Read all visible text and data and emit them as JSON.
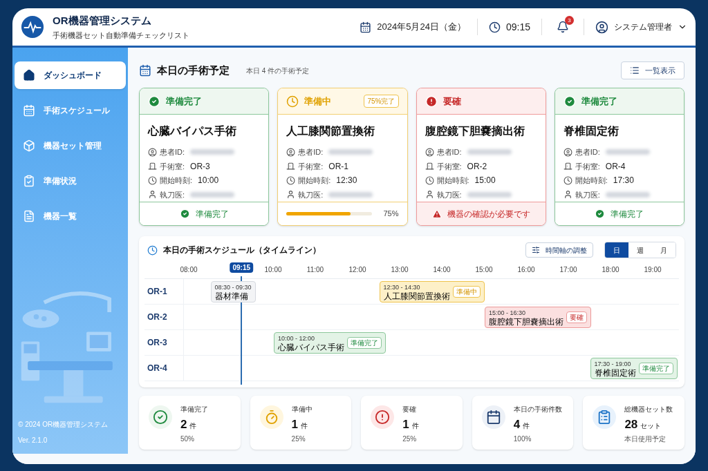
{
  "header": {
    "title": "OR機器管理システム",
    "subtitle": "手術機器セット自動準備チェックリスト",
    "date": "2024年5月24日（金）",
    "time": "09:15",
    "notification_count": "3",
    "user": "システム管理者"
  },
  "sidebar": {
    "items": [
      {
        "label": "ダッシュボード",
        "selected": true
      },
      {
        "label": "手術スケジュール",
        "selected": false
      },
      {
        "label": "機器セット管理",
        "selected": false
      },
      {
        "label": "準備状況",
        "selected": false
      },
      {
        "label": "機器一覧",
        "selected": false
      }
    ],
    "copyright": "© 2024 OR機器管理システム",
    "version": "Ver. 2.1.0"
  },
  "today": {
    "title": "本日の手術予定",
    "summary": "本日 4 件の手術予定",
    "list_button": "一覧表示"
  },
  "cards": [
    {
      "kind": "done",
      "status_label": "準備完了",
      "title": "心臓バイパス手術",
      "rows": [
        {
          "label": "患者ID:",
          "redacted": true
        },
        {
          "label": "手術室:",
          "value": "OR-3",
          "redacted": false
        },
        {
          "label": "開始時刻:",
          "value": "10:00",
          "redacted": false
        },
        {
          "label": "執刀医:",
          "redacted": true
        }
      ],
      "footer": "準備完了"
    },
    {
      "kind": "progress",
      "status_label": "準備中",
      "badge": "75%完了",
      "title": "人工膝関節置換術",
      "rows": [
        {
          "label": "患者ID:",
          "redacted": true
        },
        {
          "label": "手術室:",
          "value": "OR-1",
          "redacted": false
        },
        {
          "label": "開始時刻:",
          "value": "12:30",
          "redacted": false
        },
        {
          "label": "執刀医:",
          "redacted": true
        }
      ],
      "level": 0.75,
      "footer": "75%"
    },
    {
      "kind": "alert",
      "status_label": "要確",
      "title": "腹腔鏡下胆嚢摘出術",
      "rows": [
        {
          "label": "患者ID:",
          "redacted": true
        },
        {
          "label": "手術室:",
          "value": "OR-2",
          "redacted": false
        },
        {
          "label": "開始時刻:",
          "value": "15:00",
          "redacted": false
        },
        {
          "label": "執刀医:",
          "redacted": true
        }
      ],
      "footer": "機器の確認が必要です"
    },
    {
      "kind": "done",
      "status_label": "準備完了",
      "title": "脊椎固定術",
      "rows": [
        {
          "label": "患者ID:",
          "redacted": true
        },
        {
          "label": "手術室:",
          "value": "OR-4",
          "redacted": false
        },
        {
          "label": "開始時刻:",
          "value": "17:30",
          "redacted": false
        },
        {
          "label": "執刀医:",
          "redacted": true
        }
      ],
      "footer": "準備完了"
    }
  ],
  "timeline": {
    "title": "本日の手術スケジュール（タイムライン）",
    "adjust_button": "時間軸の調整",
    "views": [
      {
        "label": "日",
        "selected": true
      },
      {
        "label": "週",
        "selected": false
      },
      {
        "label": "月",
        "selected": false
      }
    ],
    "hours": [
      "08:00",
      "10:00",
      "11:00",
      "12:00",
      "13:00",
      "14:00",
      "15:00",
      "16:00",
      "17:00",
      "18:00",
      "19:00"
    ],
    "now": "09:15",
    "rooms": [
      {
        "label": "OR-1",
        "events": [
          {
            "kind": "neutral",
            "time": "08:30 - 09:30",
            "title": "器材準備"
          },
          {
            "kind": "progress",
            "time": "12:30 - 14:30",
            "title": "人工膝関節置換術",
            "badge": "準備中"
          }
        ]
      },
      {
        "label": "OR-2",
        "events": [
          {
            "kind": "alert",
            "time": "15:00 - 16:30",
            "title": "腹腔鏡下胆嚢摘出術",
            "badge": "要確"
          }
        ]
      },
      {
        "label": "OR-3",
        "events": [
          {
            "kind": "done",
            "time": "10:00 - 12:00",
            "title": "心臓バイパス手術",
            "badge": "準備完了"
          }
        ]
      },
      {
        "label": "OR-4",
        "events": [
          {
            "kind": "done",
            "time": "17:30 - 19:00",
            "title": "脊椎固定術",
            "badge": "準備完了"
          }
        ]
      }
    ]
  },
  "stats": [
    {
      "kind": "done",
      "label": "準備完了",
      "value": "2",
      "unit": "件",
      "note": "50%"
    },
    {
      "kind": "progress",
      "label": "準備中",
      "value": "1",
      "unit": "件",
      "note": "25%"
    },
    {
      "kind": "alert",
      "label": "要確",
      "value": "1",
      "unit": "件",
      "note": "25%"
    },
    {
      "kind": "count",
      "label": "本日の手術件数",
      "value": "4",
      "unit": "件",
      "note": "100%"
    },
    {
      "kind": "sets",
      "label": "総機器セット数",
      "value": "28",
      "unit": "セット",
      "note": "本日使用予定"
    }
  ]
}
